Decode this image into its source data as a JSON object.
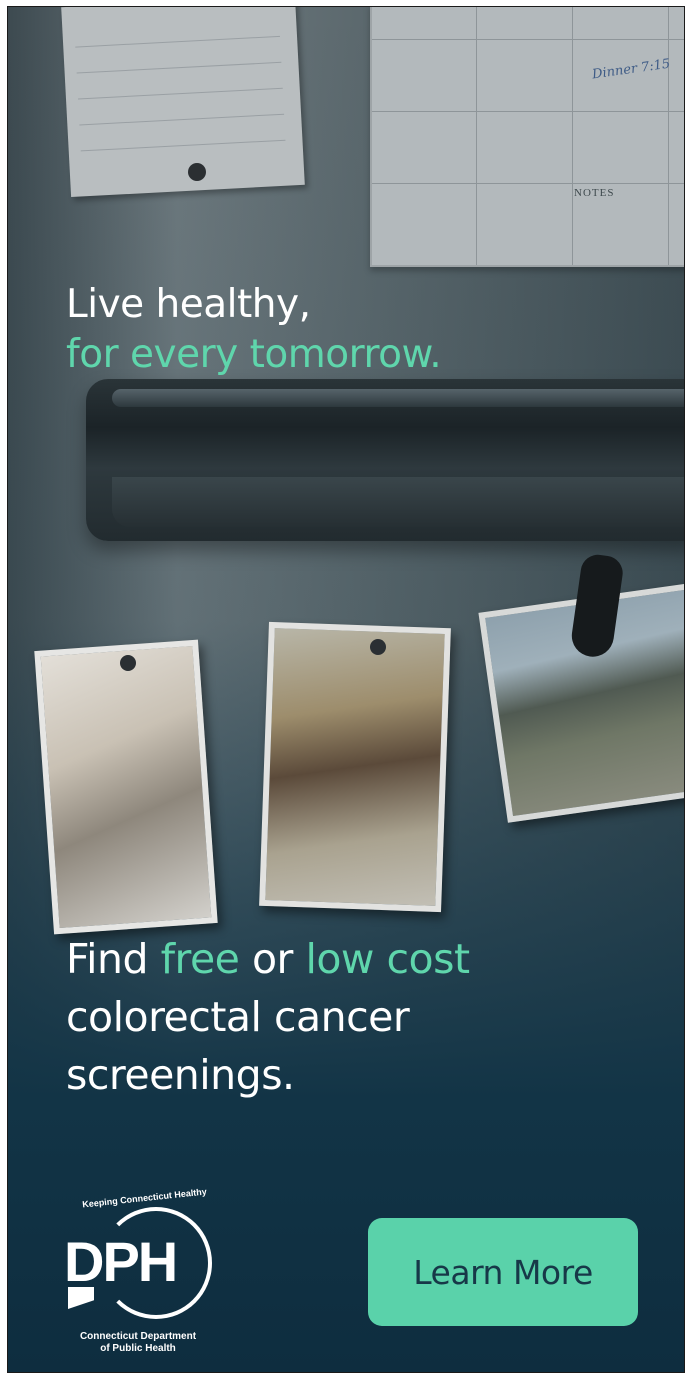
{
  "headline_top": {
    "line1": "Live healthy,",
    "line2": "for every tomorrow."
  },
  "headline_bottom": {
    "find": "Find",
    "free": "free",
    "or": "or",
    "low_cost": "low cost",
    "line2": "colorectal cancer",
    "line3": "screenings."
  },
  "calendar": {
    "notes_label": "NOTES",
    "dinner_note": "Dinner 7:15"
  },
  "logo": {
    "arc_text": "Keeping Connecticut Healthy",
    "letters": "DPH",
    "org_line1": "Connecticut Department",
    "org_line2": "of Public Health"
  },
  "cta": {
    "label": "Learn More"
  },
  "colors": {
    "accent": "#5fd6ac",
    "button": "#5ad2aa",
    "button_text": "#173848",
    "background_dark": "#0e2d3f"
  }
}
